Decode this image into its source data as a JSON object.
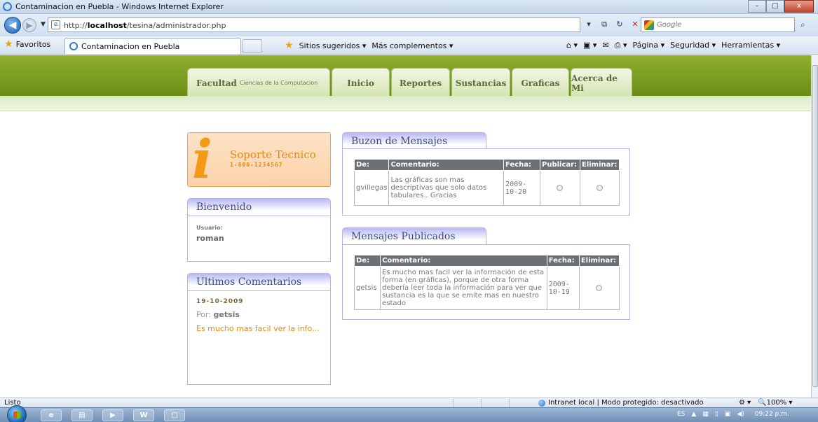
{
  "window": {
    "title": "Contaminacion en Puebla - Windows Internet Explorer",
    "minimize_glyph": "–",
    "maximize_glyph": "□",
    "close_glyph": "x"
  },
  "address_bar": {
    "url_prefix": "http://",
    "url_host": "localhost",
    "url_path": "/tesina/administrador.php",
    "search_placeholder": "Google"
  },
  "favorites_bar": {
    "favorites_label": "Favoritos",
    "tab_title": "Contaminacion en Puebla",
    "sitios_label": "Sitios sugeridos ▾",
    "complementos_label": "Más complementos ▾",
    "pagina_label": "Página ▾",
    "seguridad_label": "Seguridad ▾",
    "herramientas_label": "Herramientas ▾"
  },
  "site": {
    "nav": {
      "facultad_label": "Facultad",
      "facultad_sub": "Ciencias de la Computacion",
      "items": [
        "Inicio",
        "Reportes",
        "Sustancias",
        "Graficas",
        "Acerca de Mi"
      ]
    },
    "support": {
      "icon_letter": "i",
      "title": "Soporte Tecnico",
      "phone": "1-800-1234567"
    },
    "welcome": {
      "heading": "Bienvenido",
      "user_label": "Usuario:",
      "user_value": "roman"
    },
    "recent_comments": {
      "heading": "Ultimos Comentarios",
      "date": "19-10-2009",
      "by_label": "Por:",
      "author": "getsis",
      "excerpt": "Es mucho mas facil ver la info..."
    },
    "inbox": {
      "heading": "Buzon de Mensajes",
      "columns": [
        "De:",
        "Comentario:",
        "Fecha:",
        "Publicar:",
        "Eliminar:"
      ],
      "rows": [
        {
          "from": "gvillegas",
          "comment": "Las gráficas son mas descriptivas que solo datos tabulares.. Gracias",
          "date": "2009-10-20"
        }
      ]
    },
    "published": {
      "heading": "Mensajes Publicados",
      "columns": [
        "De:",
        "Comentario:",
        "Fecha:",
        "Eliminar:"
      ],
      "rows": [
        {
          "from": "getsis",
          "comment": "Es mucho mas facil ver la información de esta forma (en gráficas), porque de otra forma debería leer toda la información para ver que sustancia es la que se emite mas en nuestro estado",
          "date": "2009-10-19"
        }
      ]
    }
  },
  "status_bar": {
    "status": "Listo",
    "zone": "Intranet local | Modo protegido: desactivado",
    "zoom": "100%"
  },
  "taskbar": {
    "lang": "ES",
    "clock": "09:22 p.m."
  },
  "colors": {
    "header_green": "#7a9c1f",
    "nav_text": "#5b6a3a",
    "accent_orange": "#f39a15",
    "box_border": "#b4b6e8",
    "table_header": "#6b7176"
  }
}
